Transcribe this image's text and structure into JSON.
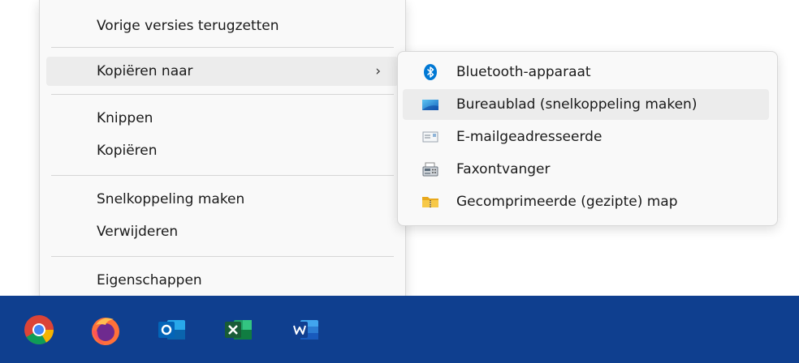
{
  "context_menu": {
    "items": [
      {
        "label": "Vorige versies terugzetten"
      },
      {
        "label": "Kopiëren naar",
        "chevron": "›"
      },
      {
        "label": "Knippen"
      },
      {
        "label": "Kopiëren"
      },
      {
        "label": "Snelkoppeling maken"
      },
      {
        "label": "Verwijderen"
      },
      {
        "label": "Eigenschappen"
      }
    ]
  },
  "submenu": {
    "items": [
      {
        "label": "Bluetooth-apparaat",
        "icon": "bluetooth-icon"
      },
      {
        "label": "Bureaublad (snelkoppeling maken)",
        "icon": "desktop-icon"
      },
      {
        "label": "E-mailgeadresseerde",
        "icon": "mail-recipient-icon"
      },
      {
        "label": "Faxontvanger",
        "icon": "fax-icon"
      },
      {
        "label": "Gecomprimeerde (gezipte) map",
        "icon": "zip-folder-icon"
      }
    ]
  },
  "taskbar": {
    "apps": [
      "chrome-icon",
      "firefox-icon",
      "outlook-icon",
      "excel-icon",
      "word-icon"
    ],
    "color": "#0f3f8f"
  },
  "colors": {
    "menu_bg": "#f9f9f9",
    "hover_bg": "#ececec",
    "bluetooth": "#0078d4"
  }
}
